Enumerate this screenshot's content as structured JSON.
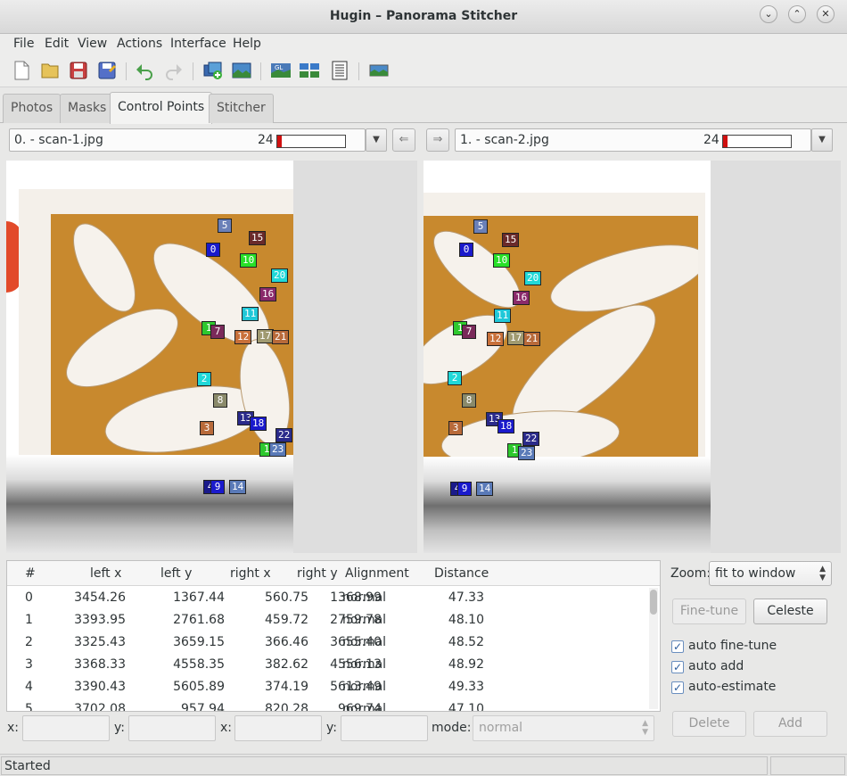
{
  "window": {
    "title": "Hugin – Panorama Stitcher"
  },
  "menu": [
    "File",
    "Edit",
    "View",
    "Actions",
    "Interface",
    "Help"
  ],
  "tabs": [
    "Photos",
    "Masks",
    "Control Points",
    "Stitcher"
  ],
  "active_tab": "Control Points",
  "left_image": {
    "label": "0. - scan-1.jpg",
    "count": "24",
    "progress": 0.06
  },
  "right_image": {
    "label": "1. - scan-2.jpg",
    "count": "24",
    "progress": 0.06
  },
  "point_colors": {
    "0": "#1a1acc",
    "1": "#2ec82e",
    "2": "#20d8d8",
    "3": "#b86a3a",
    "4": "#1a1a8a",
    "5": "#6a80b8",
    "7": "#7a2a5a",
    "8": "#8a8a6a",
    "9": "#1a1acc",
    "10": "#28e028",
    "11": "#20c8d8",
    "12": "#c8703a",
    "13": "#2a2a8a",
    "14": "#5a7ab8",
    "15": "#6a2a2a",
    "16": "#8a2a6a",
    "17": "#a09a70",
    "18": "#1a1acc",
    "20": "#20d8d8",
    "21": "#b86a3a",
    "22": "#2a2a8a",
    "23": "#5a7ab8"
  },
  "table": {
    "headers": [
      "#",
      "left x",
      "left y",
      "right x",
      "right y",
      "Alignment",
      "Distance"
    ],
    "rows": [
      [
        "0",
        "3454.26",
        "1367.44",
        "560.75",
        "1368.99",
        "normal",
        "47.33"
      ],
      [
        "1",
        "3393.95",
        "2761.68",
        "459.72",
        "2759.78",
        "normal",
        "48.10"
      ],
      [
        "2",
        "3325.43",
        "3659.15",
        "366.46",
        "3655.40",
        "normal",
        "48.52"
      ],
      [
        "3",
        "3368.33",
        "4558.35",
        "382.62",
        "4556.13",
        "normal",
        "48.92"
      ],
      [
        "4",
        "3390.43",
        "5605.89",
        "374.19",
        "5613.49",
        "normal",
        "49.33"
      ],
      [
        "5",
        "3702.08",
        "957.94",
        "820.28",
        "969.74",
        "normal",
        "47.10"
      ]
    ]
  },
  "edit": {
    "x_label": "x:",
    "y_label": "y:",
    "mode_label": "mode:",
    "mode_value": "normal"
  },
  "right_panel": {
    "zoom_label": "Zoom:",
    "zoom_value": "fit to window",
    "finetune": "Fine-tune",
    "celeste": "Celeste",
    "checks": [
      "auto fine-tune",
      "auto add",
      "auto-estimate"
    ],
    "delete": "Delete",
    "add": "Add"
  },
  "status": {
    "text": "Started"
  }
}
